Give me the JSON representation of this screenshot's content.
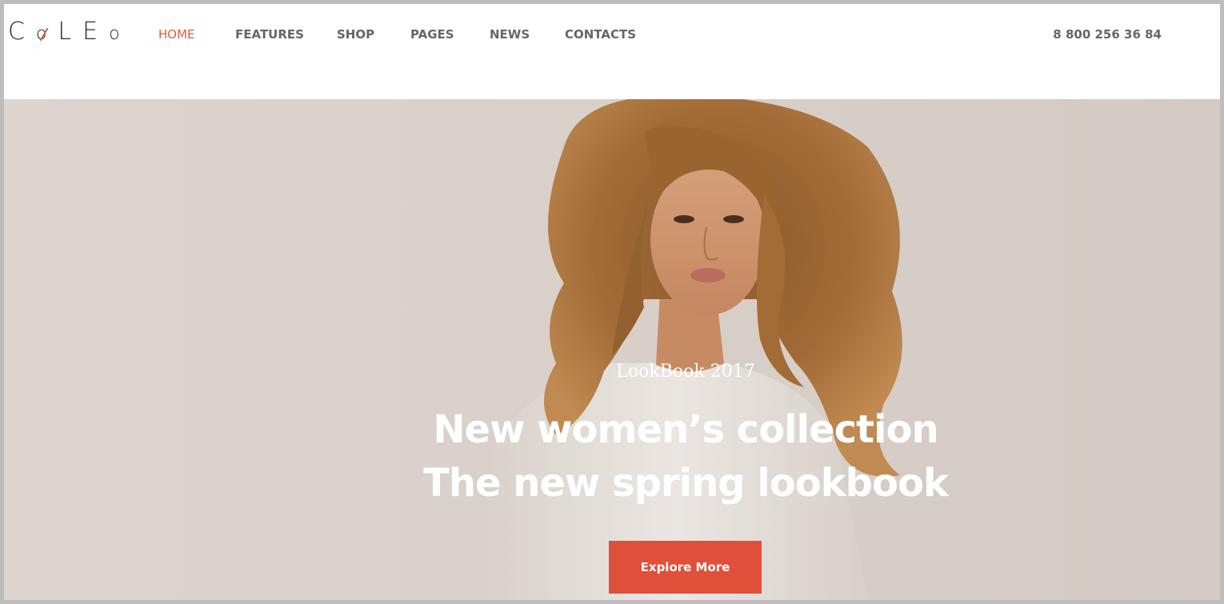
{
  "brand": {
    "logo_letters": [
      "C",
      "o",
      "L",
      "E",
      "o"
    ],
    "accent_color": "#e05a43"
  },
  "nav": {
    "items": [
      {
        "label": "HOME",
        "active": true
      },
      {
        "label": "FEATURES",
        "active": false
      },
      {
        "label": "SHOP",
        "active": false
      },
      {
        "label": "PAGES",
        "active": false
      },
      {
        "label": "NEWS",
        "active": false
      },
      {
        "label": "CONTACTS",
        "active": false
      }
    ]
  },
  "header": {
    "phone": "8 800 256 36 84"
  },
  "hero": {
    "kicker": "LookBook 2017",
    "headline_line1": "New women’s collection",
    "headline_line2": "The new spring lookbook",
    "cta_label": "Explore More",
    "cta_color": "#e04f3a"
  }
}
